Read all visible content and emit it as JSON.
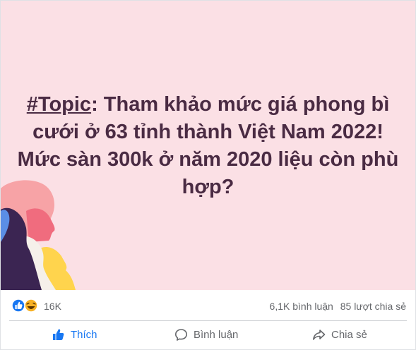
{
  "post": {
    "topic_tag": "#Topic",
    "headline": ": Tham khảo mức giá phong bì cưới ở 63 tỉnh thành Việt Nam 2022! Mức sàn 300k ở năm 2020 liệu còn phù hợp?"
  },
  "stats": {
    "reactions": "16K",
    "comments": "6,1K bình luận",
    "shares": "85 lượt chia sẻ"
  },
  "actions": {
    "like": "Thích",
    "comment": "Bình luận",
    "share": "Chia sẻ"
  },
  "colors": {
    "banner_bg": "#fbe0e5",
    "headline": "#4a2b43",
    "like_blue": "#1877f2",
    "muted": "#65676b"
  },
  "icons": [
    "like-reaction-icon",
    "haha-reaction-icon",
    "like-icon",
    "comment-icon",
    "share-icon"
  ]
}
